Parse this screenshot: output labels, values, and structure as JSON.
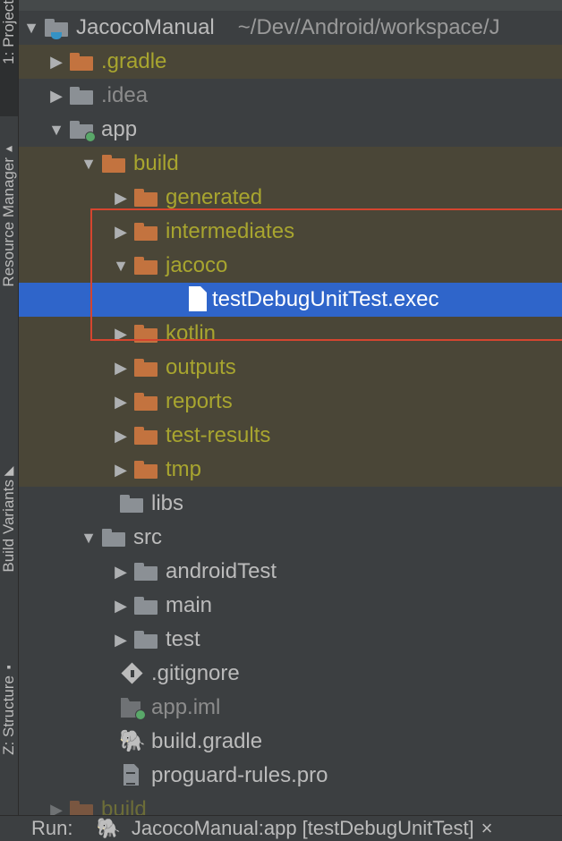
{
  "sidebar": {
    "project_tab": "1: Project",
    "resource_manager_tab": "Resource Manager",
    "build_variants_tab": "Build Variants",
    "structure_tab": "Z: Structure"
  },
  "tree": {
    "root_name": "JacocoManual",
    "root_path": "~/Dev/Android/workspace/J",
    "items": [
      {
        "label": ".gradle"
      },
      {
        "label": ".idea"
      },
      {
        "label": "app"
      },
      {
        "label": "build"
      },
      {
        "label": "generated"
      },
      {
        "label": "intermediates"
      },
      {
        "label": "jacoco"
      },
      {
        "label": "testDebugUnitTest.exec"
      },
      {
        "label": "kotlin"
      },
      {
        "label": "outputs"
      },
      {
        "label": "reports"
      },
      {
        "label": "test-results"
      },
      {
        "label": "tmp"
      },
      {
        "label": "libs"
      },
      {
        "label": "src"
      },
      {
        "label": "androidTest"
      },
      {
        "label": "main"
      },
      {
        "label": "test"
      },
      {
        "label": ".gitignore"
      },
      {
        "label": "app.iml"
      },
      {
        "label": "build.gradle"
      },
      {
        "label": "proguard-rules.pro"
      },
      {
        "label": "build"
      }
    ]
  },
  "run": {
    "label": "Run:",
    "config": "JacocoManual:app [testDebugUnitTest]",
    "close": "×"
  },
  "colors": {
    "selection": "#2f65ca",
    "excluded_bg": "#4a4637",
    "excluded_text": "#a8a52f",
    "folder_orange": "#c3733f",
    "highlight_border": "#d5452f"
  }
}
